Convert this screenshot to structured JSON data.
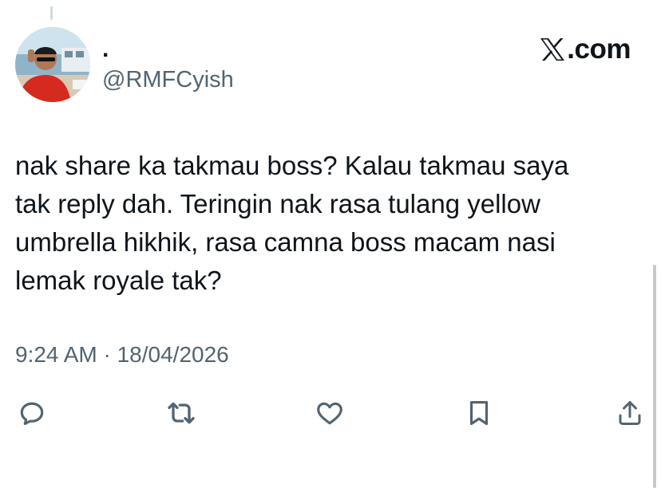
{
  "tweet": {
    "author": {
      "display_name": ".",
      "handle": "@RMFCyish"
    },
    "brand": {
      "logo_letter": "𝕏",
      "text": ".com"
    },
    "text": "nak share ka takmau boss? Kalau takmau saya\ntak reply dah. Teringin nak rasa tulang yellow\numbrella hikhik, rasa camna boss macam nasi\nlemak royale tak?",
    "timestamp": "9:24 AM · 18/04/2026"
  },
  "actions": [
    {
      "name": "reply",
      "icon": "reply-icon"
    },
    {
      "name": "repost",
      "icon": "repost-icon"
    },
    {
      "name": "like",
      "icon": "heart-icon"
    },
    {
      "name": "bookmark",
      "icon": "bookmark-icon"
    },
    {
      "name": "share",
      "icon": "share-icon"
    }
  ],
  "colors": {
    "text_primary": "#0f1419",
    "text_secondary": "#536471",
    "background": "#ffffff",
    "icon": "#536471"
  }
}
